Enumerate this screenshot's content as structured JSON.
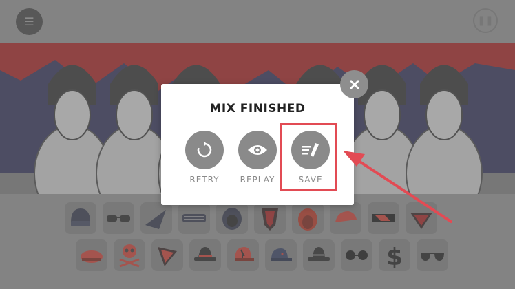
{
  "header": {
    "menu_icon": "hamburger-icon",
    "pause_icon": "pause-icon"
  },
  "modal": {
    "title": "MIX FINISHED",
    "actions": [
      {
        "label": "RETRY",
        "icon": "retry-icon"
      },
      {
        "label": "REPLAY",
        "icon": "eye-icon"
      },
      {
        "label": "SAVE",
        "icon": "save-pencil-icon"
      }
    ],
    "close_icon": "close-icon"
  },
  "palette": {
    "row1": [
      "beanie-hat",
      "sunglasses",
      "dark-shard",
      "shutter-shades",
      "hood",
      "shield-mask",
      "red-hair",
      "red-cap",
      "visor-glasses",
      "red-bandana"
    ],
    "row2": [
      "red-beret",
      "skull-crossbones",
      "red-triangle",
      "trilby-hat",
      "red-trucker-cap",
      "blue-cap",
      "fedora-hat",
      "round-glasses",
      "dollar-sign",
      "aviator-glasses"
    ]
  },
  "colors": {
    "accent": "#e24b54",
    "button_gray": "#8a8a8a",
    "stage_red": "#a31a1a",
    "stage_blue": "#2a2a52"
  }
}
